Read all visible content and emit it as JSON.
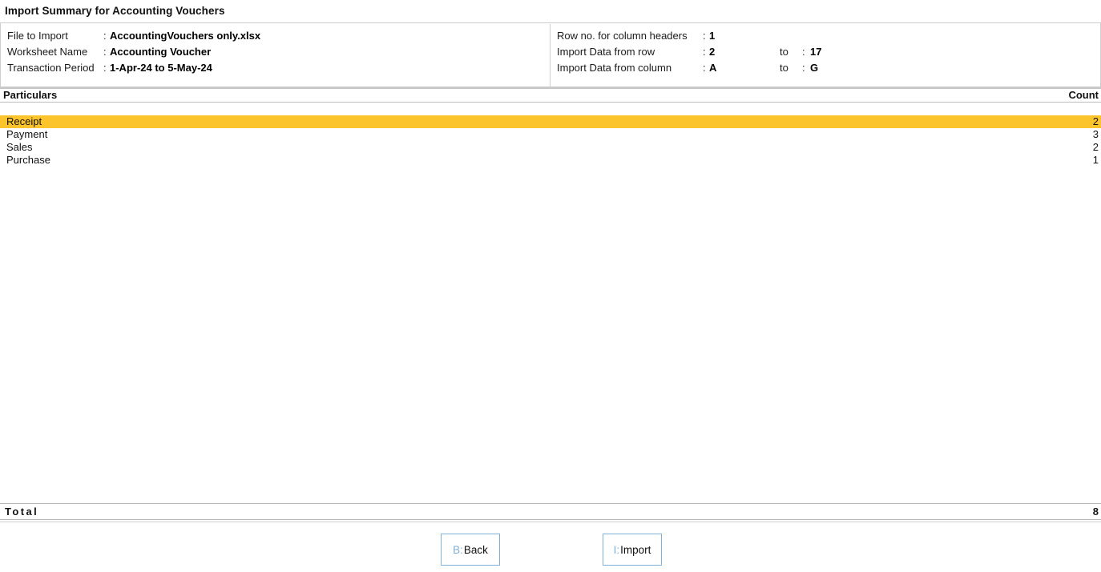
{
  "page_title": "Import Summary for Accounting Vouchers",
  "info": {
    "left_rows": [
      {
        "label": "File to Import",
        "colon": ":",
        "value": "AccountingVouchers only.xlsx"
      },
      {
        "label": "Worksheet Name",
        "colon": ":",
        "value": "Accounting Voucher"
      },
      {
        "label": "Transaction Period",
        "colon": ":",
        "value": "1-Apr-24 to 5-May-24"
      }
    ],
    "right_rows": [
      {
        "label": "Row no. for column headers",
        "colon": ":",
        "value": "1",
        "to": "",
        "colon2": "",
        "value2": ""
      },
      {
        "label": "Import Data from row",
        "colon": ":",
        "value": "2",
        "to": "to",
        "colon2": ":",
        "value2": "17"
      },
      {
        "label": "Import Data from column",
        "colon": ":",
        "value": "A",
        "to": "to",
        "colon2": ":",
        "value2": "G"
      }
    ]
  },
  "table": {
    "columns": {
      "particulars": "Particulars",
      "count": "Count"
    },
    "rows": [
      {
        "name": "Receipt",
        "count": "2",
        "selected": true
      },
      {
        "name": "Payment",
        "count": "3",
        "selected": false
      },
      {
        "name": "Sales",
        "count": "2",
        "selected": false
      },
      {
        "name": "Purchase",
        "count": "1",
        "selected": false
      }
    ],
    "total": {
      "label": "Total",
      "value": "8"
    }
  },
  "buttons": [
    {
      "id": "btn-back",
      "accel": "B:",
      "label": "Back",
      "name": "back-button"
    },
    {
      "id": "btn-import",
      "accel": "I:",
      "label": "Import",
      "name": "import-button"
    }
  ],
  "colors": {
    "selection": "#fcc42c",
    "accel": "#7fb0d8",
    "border": "#cfcfcf"
  }
}
